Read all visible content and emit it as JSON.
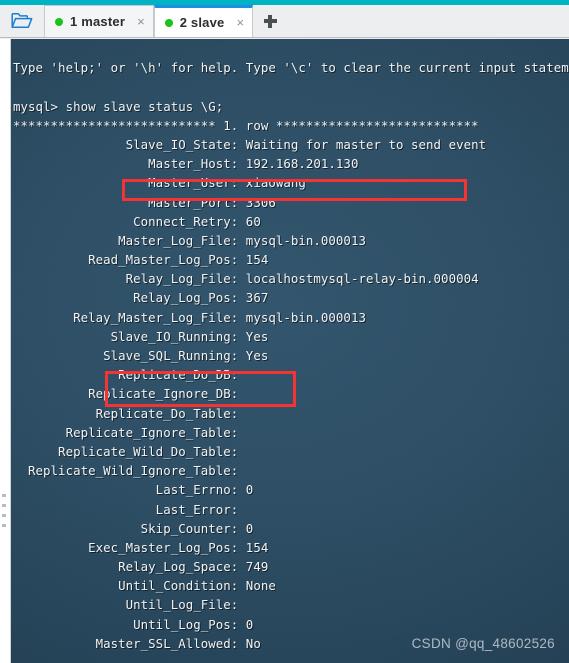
{
  "window": {
    "accent_teal": "#00b3c4",
    "tabbar_bg": "#eceef0",
    "active_tab_border": "#1e8fe0"
  },
  "toolbar": {
    "folder_icon": "folder-open-icon",
    "add_tab_label": "+"
  },
  "tabs": [
    {
      "label": "1 master",
      "status_dot_color": "#19c319",
      "close_label": "×",
      "active": false
    },
    {
      "label": "2 slave",
      "status_dot_color": "#19c319",
      "close_label": "×",
      "active": true
    }
  ],
  "terminal": {
    "background": "#2e4f66",
    "foreground": "#f2f4f5",
    "lines": [
      "",
      "Type 'help;' or '\\h' for help. Type '\\c' to clear the current input statement.",
      "",
      "mysql> show slave status \\G;",
      "*************************** 1. row ***************************",
      "               Slave_IO_State: Waiting for master to send event",
      "                  Master_Host: 192.168.201.130",
      "                  Master_User: xiaowang",
      "                  Master_Port: 3306",
      "                Connect_Retry: 60",
      "              Master_Log_File: mysql-bin.000013",
      "          Read_Master_Log_Pos: 154",
      "               Relay_Log_File: localhostmysql-relay-bin.000004",
      "                Relay_Log_Pos: 367",
      "        Relay_Master_Log_File: mysql-bin.000013",
      "             Slave_IO_Running: Yes",
      "            Slave_SQL_Running: Yes",
      "              Replicate_Do_DB:",
      "          Replicate_Ignore_DB:",
      "           Replicate_Do_Table:",
      "       Replicate_Ignore_Table:",
      "      Replicate_Wild_Do_Table:",
      "  Replicate_Wild_Ignore_Table:",
      "                   Last_Errno: 0",
      "                   Last_Error:",
      "                 Skip_Counter: 0",
      "          Exec_Master_Log_Pos: 154",
      "              Relay_Log_Space: 749",
      "              Until_Condition: None",
      "               Until_Log_File:",
      "                Until_Log_Pos: 0",
      "           Master_SSL_Allowed: No"
    ]
  },
  "annotations": {
    "color": "#f53333",
    "boxes": [
      {
        "name": "slave-io-state-highlight",
        "target": "Slave_IO_State: Waiting for master to send event"
      },
      {
        "name": "slave-running-highlight",
        "target": "Slave_IO_Running: Yes / Slave_SQL_Running: Yes"
      }
    ]
  },
  "watermark": {
    "text": "CSDN @qq_48602526"
  }
}
